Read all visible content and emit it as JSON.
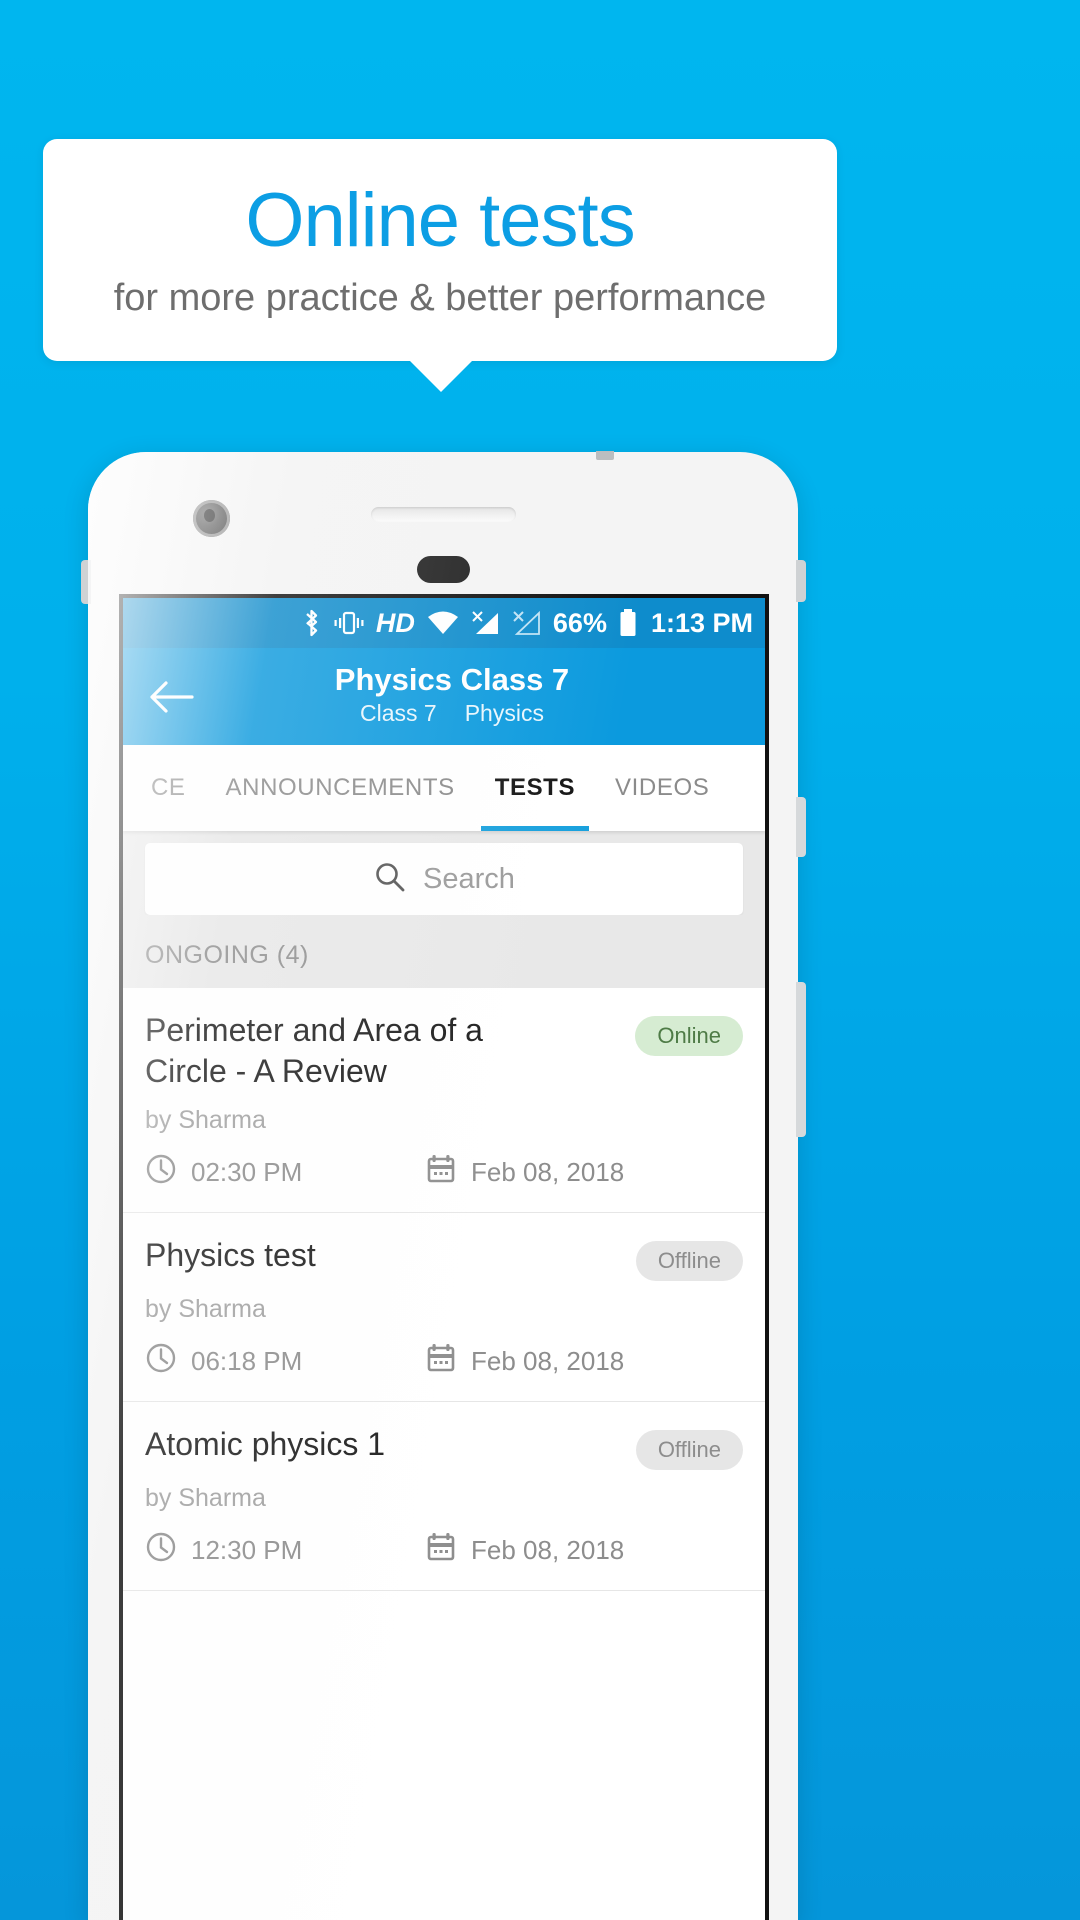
{
  "promo": {
    "title": "Online tests",
    "subtitle": "for more practice & better performance",
    "title_color": "#0c9ee4",
    "subtitle_color": "#6e6e6e",
    "background_color": "#00b0ec"
  },
  "status_bar": {
    "icons": [
      "bluetooth-icon",
      "vibrate-icon",
      "hd-icon",
      "wifi-icon",
      "signal-1-icon",
      "signal-2-icon"
    ],
    "hd_label": "HD",
    "battery_percent": "66%",
    "time": "1:13 PM",
    "background_color": "#0e8ccc"
  },
  "app_bar": {
    "back_icon": "arrow-left-icon",
    "title": "Physics Class 7",
    "subtitle_class": "Class 7",
    "subtitle_subject": "Physics",
    "background_color": "#0b9ade"
  },
  "tabs": {
    "items": [
      {
        "label": "CE",
        "active": false
      },
      {
        "label": "ANNOUNCEMENTS",
        "active": false
      },
      {
        "label": "TESTS",
        "active": true
      },
      {
        "label": "VIDEOS",
        "active": false
      }
    ],
    "indicator_color": "#17a0dd"
  },
  "search": {
    "icon": "search-icon",
    "placeholder": "Search",
    "value": ""
  },
  "section": {
    "label": "ONGOING (4)"
  },
  "tests": [
    {
      "title": "Perimeter and Area of a Circle - A Review",
      "author": "by Sharma",
      "status": "Online",
      "status_type": "online",
      "time": "02:30 PM",
      "date": "Feb 08, 2018",
      "time_icon": "clock-icon",
      "date_icon": "calendar-icon"
    },
    {
      "title": "Physics test",
      "author": "by Sharma",
      "status": "Offline",
      "status_type": "offline",
      "time": "06:18 PM",
      "date": "Feb 08, 2018",
      "time_icon": "clock-icon",
      "date_icon": "calendar-icon"
    },
    {
      "title": "Atomic physics 1",
      "author": "by Sharma",
      "status": "Offline",
      "status_type": "offline",
      "time": "12:30 PM",
      "date": "Feb 08, 2018",
      "time_icon": "clock-icon",
      "date_icon": "calendar-icon"
    }
  ]
}
